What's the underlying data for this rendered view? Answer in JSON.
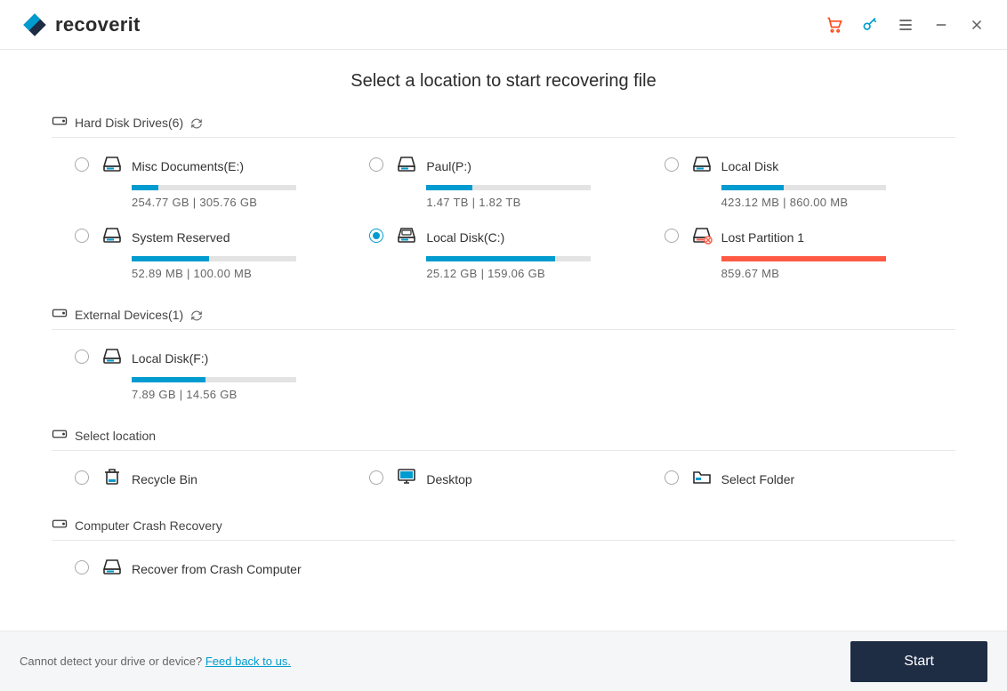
{
  "app": {
    "name": "recoverit"
  },
  "header": {
    "title": "Select a location to start recovering file"
  },
  "sections": {
    "hdd": {
      "label": "Hard Disk Drives(6)"
    },
    "ext": {
      "label": "External Devices(1)"
    },
    "sel": {
      "label": "Select location"
    },
    "crash": {
      "label": "Computer Crash Recovery"
    }
  },
  "drives": {
    "hdd": [
      {
        "name": "Misc Documents(E:)",
        "meta": "254.77  GB | 305.76  GB",
        "pct": 16,
        "selected": false,
        "lost": false
      },
      {
        "name": "Paul(P:)",
        "meta": "1.47  TB | 1.82  TB",
        "pct": 28,
        "selected": false,
        "lost": false
      },
      {
        "name": "Local Disk",
        "meta": "423.12  MB | 860.00  MB",
        "pct": 38,
        "selected": false,
        "lost": false
      },
      {
        "name": "System Reserved",
        "meta": "52.89  MB | 100.00  MB",
        "pct": 47,
        "selected": false,
        "lost": false
      },
      {
        "name": "Local Disk(C:)",
        "meta": "25.12  GB | 159.06  GB",
        "pct": 78,
        "selected": true,
        "lost": false,
        "system": true
      },
      {
        "name": "Lost Partition 1",
        "meta": "859.67  MB",
        "pct": 100,
        "selected": false,
        "lost": true
      }
    ],
    "ext": [
      {
        "name": "Local Disk(F:)",
        "meta": "7.89  GB | 14.56  GB",
        "pct": 45,
        "selected": false,
        "lost": false
      }
    ]
  },
  "locations": [
    {
      "name": "Recycle Bin",
      "icon": "bin"
    },
    {
      "name": "Desktop",
      "icon": "desktop"
    },
    {
      "name": "Select Folder",
      "icon": "folder"
    }
  ],
  "crash": {
    "label": "Recover from Crash Computer"
  },
  "footer": {
    "prompt": "Cannot detect your drive or device? ",
    "link": "Feed back to us.",
    "start": "Start"
  }
}
